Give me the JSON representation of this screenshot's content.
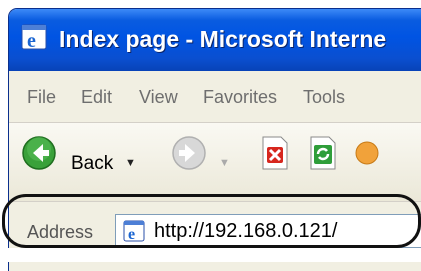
{
  "window": {
    "title": "Index page - Microsoft Interne"
  },
  "menu": {
    "items": [
      "File",
      "Edit",
      "View",
      "Favorites",
      "Tools"
    ]
  },
  "toolbar": {
    "back_label": "Back"
  },
  "address": {
    "label": "Address",
    "value": "http://192.168.0.121/"
  },
  "colors": {
    "titlebar": "#0054e3",
    "back_button": "#3aa13a",
    "highlight_ring": "#111111"
  },
  "icons": [
    "ie-icon",
    "back-arrow-icon",
    "forward-arrow-icon",
    "stop-icon",
    "refresh-icon",
    "home-icon",
    "page-ie-icon"
  ]
}
